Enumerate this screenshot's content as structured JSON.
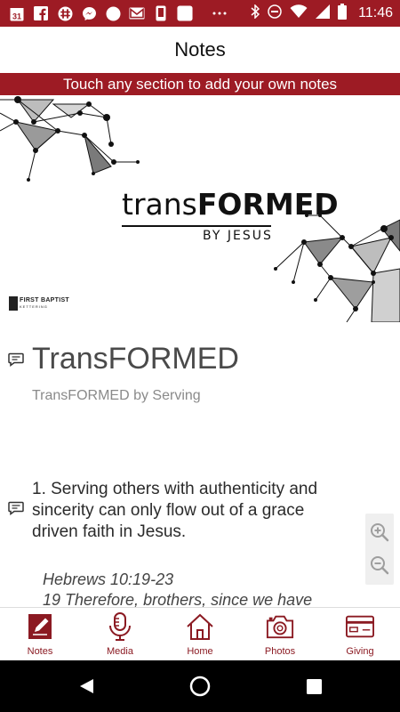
{
  "status_bar": {
    "time": "11:46",
    "calendar_day": "31",
    "left_icons": [
      "calendar-icon",
      "facebook-icon",
      "slack-icon",
      "messenger-icon",
      "circle-icon",
      "gmail-icon",
      "phone-icon",
      "square-icon",
      "more-icon"
    ],
    "right_icons": [
      "bluetooth-icon",
      "minus-circle-icon",
      "wifi-icon",
      "signal-icon",
      "battery-icon"
    ],
    "color": "#9d1b24"
  },
  "header": {
    "title": "Notes"
  },
  "banner": {
    "text": "Touch any section to add your own notes"
  },
  "hero": {
    "title_thin": "trans",
    "title_bold": "FORMED",
    "subtitle": "BY JESUS",
    "church_name": "FIRST BAPTIST",
    "church_city": "KETTERING"
  },
  "sermon": {
    "title": "TransFORMED",
    "subtitle": "TransFORMED by Serving",
    "point": "1. Serving others with authenticity and sincerity can only flow out of a grace driven faith in Jesus.",
    "verse_ref": "Hebrews 10:19-23",
    "verse_text": "19 Therefore, brothers, since we have"
  },
  "zoom": {
    "in_icon": "zoom-in-icon",
    "out_icon": "zoom-out-icon"
  },
  "bottom_nav": {
    "items": [
      {
        "label": "Notes",
        "icon": "notes-icon"
      },
      {
        "label": "Media",
        "icon": "microphone-icon"
      },
      {
        "label": "Home",
        "icon": "home-icon"
      },
      {
        "label": "Photos",
        "icon": "camera-icon"
      },
      {
        "label": "Giving",
        "icon": "credit-card-icon"
      }
    ],
    "active": "Notes",
    "accent": "#8b1a22"
  },
  "android_nav": {
    "buttons": [
      "back-icon",
      "home-circle-icon",
      "recents-icon"
    ]
  }
}
